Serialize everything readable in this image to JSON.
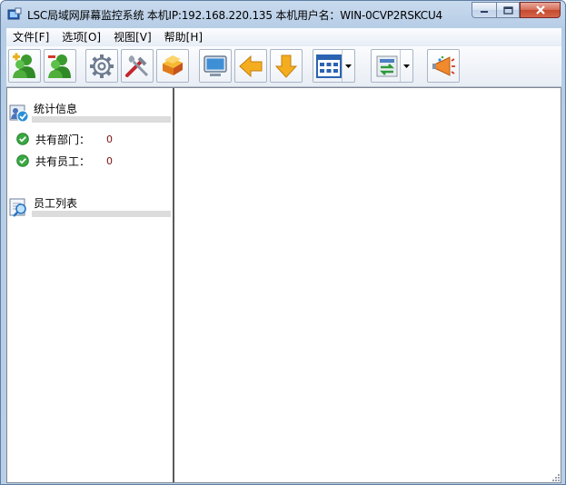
{
  "window": {
    "title": "LSC局域网屏幕监控系统    本机IP:192.168.220.135    本机用户名：WIN-0CVP2RSKCU4"
  },
  "menu": [
    {
      "label": "文件[F]"
    },
    {
      "label": "选项[O]"
    },
    {
      "label": "视图[V]"
    },
    {
      "label": "帮助[H]"
    }
  ],
  "toolbar": {
    "buttons": [
      {
        "icon": "user-add-icon"
      },
      {
        "icon": "user-remove-icon"
      },
      {
        "icon": "gear-icon"
      },
      {
        "icon": "tools-icon"
      },
      {
        "icon": "books-icon"
      },
      {
        "icon": "monitor-icon"
      },
      {
        "icon": "arrow-left-icon"
      },
      {
        "icon": "arrow-down-icon"
      },
      {
        "icon": "grid-view-icon",
        "dropdown": true
      },
      {
        "icon": "sync-icon",
        "dropdown": true
      },
      {
        "icon": "megaphone-icon"
      }
    ]
  },
  "left_panel": {
    "stats": {
      "title": "统计信息",
      "rows": [
        {
          "label": "共有部门：",
          "value": "0"
        },
        {
          "label": "共有员工：",
          "value": "0"
        }
      ]
    },
    "employees": {
      "title": "员工列表"
    }
  },
  "colors": {
    "accent_green": "#3aa843",
    "value_text": "#7a1010",
    "close_red": "#c44a2e"
  }
}
